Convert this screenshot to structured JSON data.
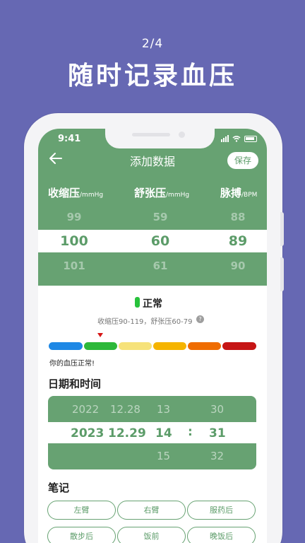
{
  "promo": {
    "step": "2/4",
    "title": "随时记录血压"
  },
  "status_bar": {
    "time": "9:41"
  },
  "nav": {
    "title": "添加数据",
    "save_label": "保存"
  },
  "columns": [
    {
      "label": "收缩压",
      "unit": "/mmHg",
      "above": "99",
      "selected": "100",
      "below": "101"
    },
    {
      "label": "舒张压",
      "unit": "/mmHg",
      "above": "59",
      "selected": "60",
      "below": "61"
    },
    {
      "label": "脉搏",
      "unit": "/BPM",
      "above": "88",
      "selected": "89",
      "below": "90"
    }
  ],
  "status": {
    "label": "正常",
    "range_text": "收缩压90-119，舒张压60-79",
    "help": "?",
    "message": "你的血压正常!",
    "indicator_color": "#28c23c",
    "scale_colors": [
      "#1e88e5",
      "#2db83a",
      "#f6e27a",
      "#f5b400",
      "#ef6c00",
      "#c61515"
    ]
  },
  "datetime": {
    "heading": "日期和时间",
    "above": {
      "year": "2022",
      "date": "12.28",
      "hour": "13",
      "minute": "30"
    },
    "selected": {
      "year": "2023",
      "date": "12.29",
      "hour": "14",
      "minute": "31"
    },
    "below": {
      "year": "",
      "date": "",
      "hour": "15",
      "minute": "32"
    },
    "separator": ":"
  },
  "notes": {
    "heading": "笔记",
    "tags": [
      "左臂",
      "右臂",
      "服药后",
      "散步后",
      "饭前",
      "晚饭后"
    ]
  },
  "colors": {
    "background": "#6668b3",
    "accent": "#67a272",
    "accent_text": "#5c9c69"
  }
}
